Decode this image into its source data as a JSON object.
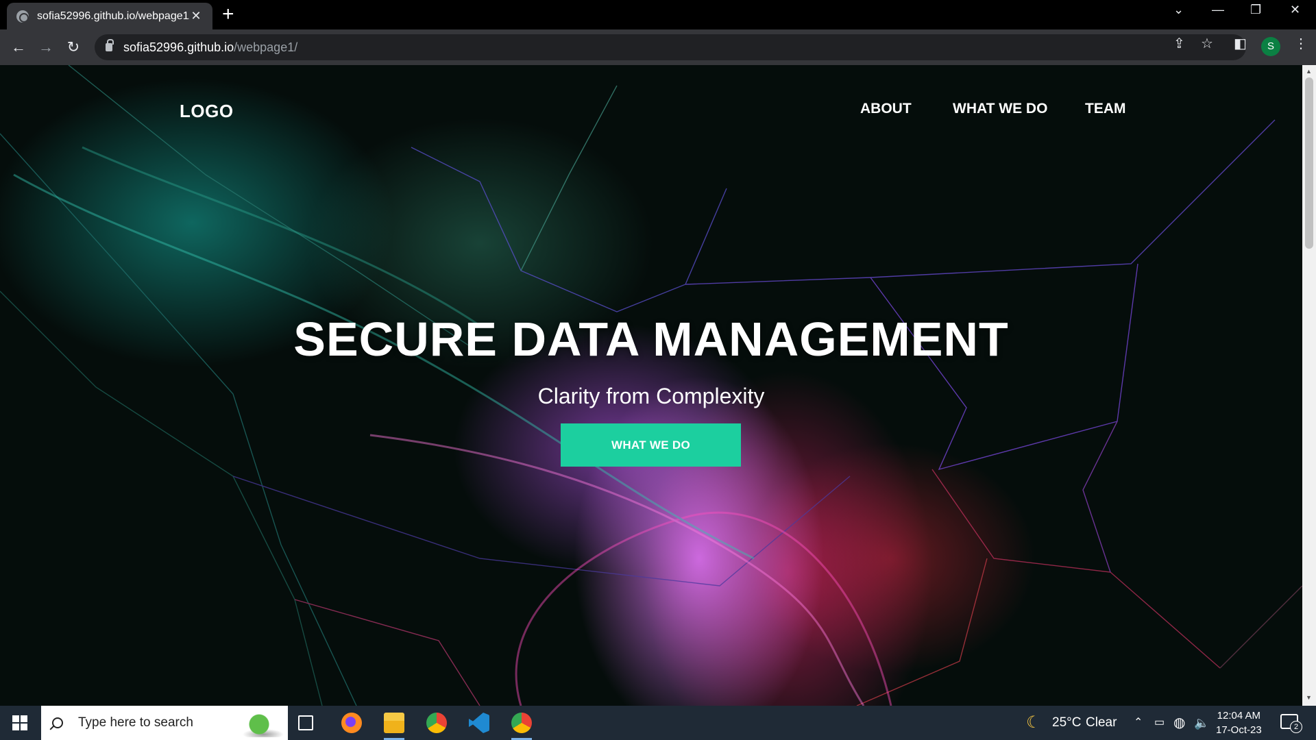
{
  "browser": {
    "tab_title": "sofia52996.github.io/webpage1/",
    "tab_close": "✕",
    "new_tab": "+",
    "url_host": "sofia52996.github.io",
    "url_path": "/webpage1/",
    "profile_initial": "S"
  },
  "page": {
    "logo": "LOGO",
    "nav": [
      "ABOUT",
      "WHAT WE DO",
      "TEAM"
    ],
    "hero_title": "SECURE DATA MANAGEMENT",
    "hero_subtitle": "Clarity from Complexity",
    "hero_button": "WHAT WE DO",
    "accent_color": "#1ccf9f"
  },
  "taskbar": {
    "search_placeholder": "Type here to search",
    "weather_temp": "25°C",
    "weather_desc": "Clear",
    "time": "12:04 AM",
    "date": "17-Oct-23",
    "notification_count": "2",
    "pinned_apps": [
      "task-view-icon",
      "firefox-icon",
      "file-explorer-icon",
      "chrome-icon",
      "vscode-icon",
      "chrome-profile-icon"
    ]
  }
}
